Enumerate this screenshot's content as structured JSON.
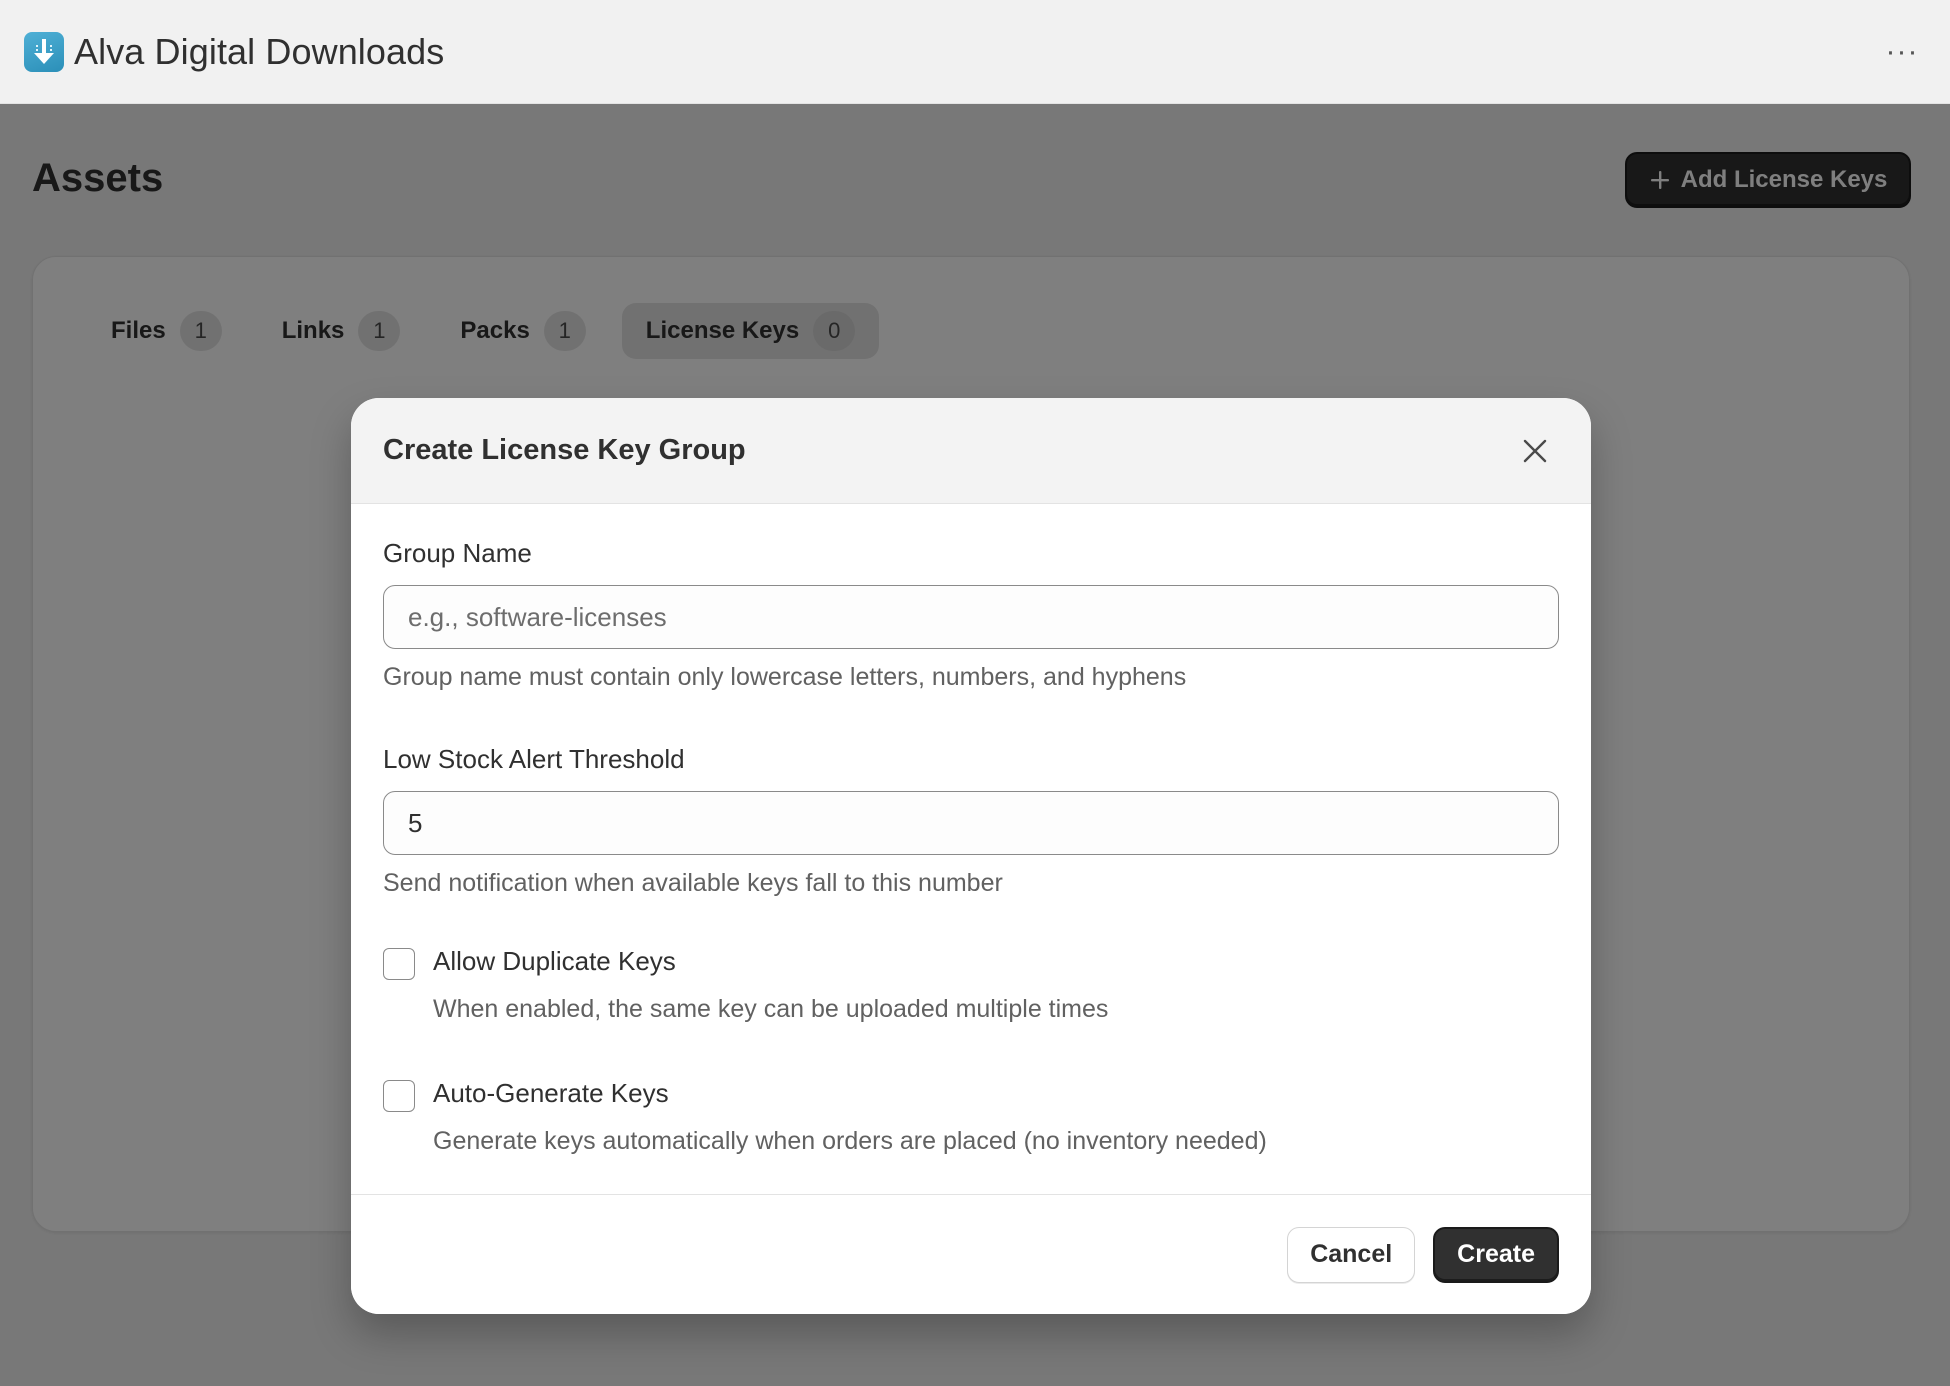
{
  "app": {
    "title": "Alva Digital Downloads",
    "logo_icon": "download-arrow-icon",
    "more_icon": "ellipsis-icon"
  },
  "page": {
    "title": "Assets",
    "add_button_label": "Add License Keys",
    "add_button_icon": "plus-icon"
  },
  "tabs": [
    {
      "label": "Files",
      "count": "1",
      "active": false
    },
    {
      "label": "Links",
      "count": "1",
      "active": false
    },
    {
      "label": "Packs",
      "count": "1",
      "active": false
    },
    {
      "label": "License Keys",
      "count": "0",
      "active": true
    }
  ],
  "modal": {
    "title": "Create License Key Group",
    "close_icon": "close-icon",
    "group_name": {
      "label": "Group Name",
      "placeholder": "e.g., software-licenses",
      "value": "",
      "help": "Group name must contain only lowercase letters, numbers, and hyphens"
    },
    "threshold": {
      "label": "Low Stock Alert Threshold",
      "value": "5",
      "help": "Send notification when available keys fall to this number"
    },
    "allow_duplicates": {
      "label": "Allow Duplicate Keys",
      "help": "When enabled, the same key can be uploaded multiple times",
      "checked": false
    },
    "auto_generate": {
      "label": "Auto-Generate Keys",
      "help": "Generate keys automatically when orders are placed (no inventory needed)",
      "checked": false
    },
    "cancel_label": "Cancel",
    "create_label": "Create"
  },
  "colors": {
    "primary_button": "#303030",
    "overlay": "rgba(0,0,0,0.5)",
    "logo": "#3aa0c8"
  }
}
